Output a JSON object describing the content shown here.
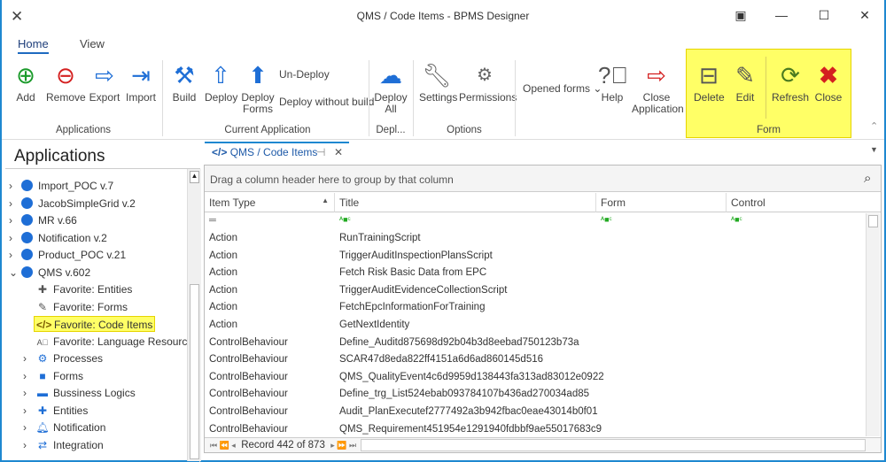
{
  "window": {
    "title": "QMS / Code Items - BPMS Designer"
  },
  "tabs": [
    "Home",
    "View"
  ],
  "ribbon": {
    "applications": {
      "label": "Applications",
      "buttons": [
        "Add",
        "Remove",
        "Export",
        "Import"
      ]
    },
    "current_application": {
      "label": "Current Application",
      "buttons": [
        "Build",
        "Deploy",
        "Deploy\nForms"
      ],
      "small": [
        "Un-Deploy",
        "Deploy without build"
      ]
    },
    "deploy": {
      "label": "Depl...",
      "buttons": [
        "Deploy\nAll"
      ]
    },
    "options": {
      "label": "Options",
      "buttons": [
        "Settings",
        "Permissions"
      ]
    },
    "misc": {
      "opened_forms": "Opened forms",
      "buttons": [
        "Help",
        "Close\nApplication"
      ]
    },
    "form": {
      "label": "Form",
      "buttons": [
        "Delete",
        "Edit",
        "Refresh",
        "Close"
      ]
    }
  },
  "left": {
    "title": "Applications",
    "tree": [
      {
        "label": "Import_POC v.7",
        "type": "app"
      },
      {
        "label": "JacobSimpleGrid v.2",
        "type": "app"
      },
      {
        "label": "MR v.66",
        "type": "app"
      },
      {
        "label": "Notification v.2",
        "type": "app"
      },
      {
        "label": "Product_POC v.21",
        "type": "app"
      },
      {
        "label": "QMS v.602",
        "type": "app-open"
      },
      {
        "label": "Favorite: Entities",
        "type": "fav"
      },
      {
        "label": "Favorite: Forms",
        "type": "fav"
      },
      {
        "label": "Favorite: Code Items",
        "type": "fav-selected"
      },
      {
        "label": "Favorite: Language Resources",
        "type": "fav"
      },
      {
        "label": "Processes",
        "type": "folder"
      },
      {
        "label": "Forms",
        "type": "folder"
      },
      {
        "label": "Bussiness Logics",
        "type": "folder"
      },
      {
        "label": "Entities",
        "type": "folder"
      },
      {
        "label": "Notification",
        "type": "folder"
      },
      {
        "label": "Integration",
        "type": "folder"
      }
    ]
  },
  "doc_tab": {
    "label": "QMS / Code Items"
  },
  "grid": {
    "group_hint": "Drag a column header here to group by that column",
    "columns": [
      "Item Type",
      "Title",
      "Form",
      "Control"
    ],
    "rows": [
      [
        "Action",
        "RunTrainingScript"
      ],
      [
        "Action",
        "TriggerAuditInspectionPlansScript"
      ],
      [
        "Action",
        "Fetch Risk Basic Data from EPC"
      ],
      [
        "Action",
        "TriggerAuditEvidenceCollectionScript"
      ],
      [
        "Action",
        "FetchEpcInformationForTraining"
      ],
      [
        "Action",
        "GetNextIdentity"
      ],
      [
        "ControlBehaviour",
        "Define_Auditd875698d92b04b3d8eebad750123b73a"
      ],
      [
        "ControlBehaviour",
        "SCAR47d8eda822ff4151a6d6ad860145d516"
      ],
      [
        "ControlBehaviour",
        "QMS_QualityEvent4c6d9959d138443fa313ad83012e0922"
      ],
      [
        "ControlBehaviour",
        "Define_trg_List524ebab093784107b436ad270034ad85"
      ],
      [
        "ControlBehaviour",
        "Audit_PlanExecutef2777492a3b942fbac0eae43014b0f01"
      ],
      [
        "ControlBehaviour",
        "QMS_Requirement451954e1291940fdbbf9ae55017683c9"
      ]
    ],
    "record": "Record 442 of 873"
  },
  "colors": {
    "accent": "#1e88d0",
    "highlight": "#ffff66"
  }
}
